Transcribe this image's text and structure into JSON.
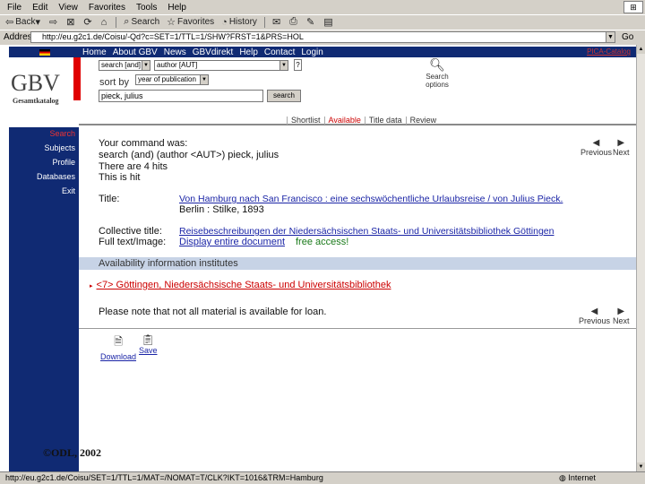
{
  "browser": {
    "menu": [
      "File",
      "Edit",
      "View",
      "Favorites",
      "Tools",
      "Help"
    ],
    "toolbar": {
      "back": "Back",
      "search": "Search",
      "favorites": "Favorites",
      "history": "History"
    },
    "address_label": "Address",
    "address_value": "http://eu.g2c1.de/Coisu/-Qd?c=SET=1/TTL=1/SHW?FRST=1&PRS=HOL",
    "go_label": "Go",
    "status_text": "http://eu.g2c1.de/Coisu/SET=1/TTL=1/MAT=/NOMAT=T/CLK?IKT=1016&TRM=Hamburg",
    "zone": "Internet"
  },
  "site": {
    "nav": [
      "Home",
      "About GBV",
      "News",
      "GBVdirekt",
      "Help",
      "Contact",
      "Login"
    ],
    "corner_link": "PICA-Catalog",
    "logo": "GBV",
    "logo_sub": "Gesamtkatalog",
    "search_form": {
      "field1": "search [and]",
      "field2": "author [AUT]",
      "sort_label": "sort by",
      "sort_value": "year of publication",
      "query": "pieck, julius",
      "search_button": "search",
      "help": "?",
      "search_options": "Search options"
    },
    "tabs": [
      "Shortlist",
      "Available",
      "Title data",
      "Review"
    ],
    "sidebar": [
      "Search",
      "Subjects",
      "Profile",
      "Databases",
      "Exit"
    ],
    "result": {
      "command_label": "Your command was:",
      "command": "search (and) (author <AUT>) pieck, julius",
      "hits": "There are 4 hits",
      "this_hit": "This is hit",
      "title_label": "Title:",
      "title_text": "Von Hamburg nach San Francisco : eine sechswöchentliche Urlaubsreise / von Julius Pieck.",
      "imprint": "Berlin : Stilke, 1893",
      "collective_label": "Collective title:",
      "collective_text": "Reisebeschreibungen der Niedersächsischen Staats- und Universitätsbibliothek Göttingen",
      "fulltext_label": "Full text/Image:",
      "fulltext_link": "Display entire document",
      "fulltext_free": "free access!",
      "availability": "Availability information institutes",
      "holding": "<7> Göttingen, Niedersächsische Staats- und Universitätsbibliothek",
      "loan_note": "Please note that not all material is available for loan.",
      "previous": "Previous",
      "next": "Next"
    },
    "actions": {
      "download": "Download",
      "save": "Save"
    },
    "copyright": "©ODL, 2002"
  }
}
